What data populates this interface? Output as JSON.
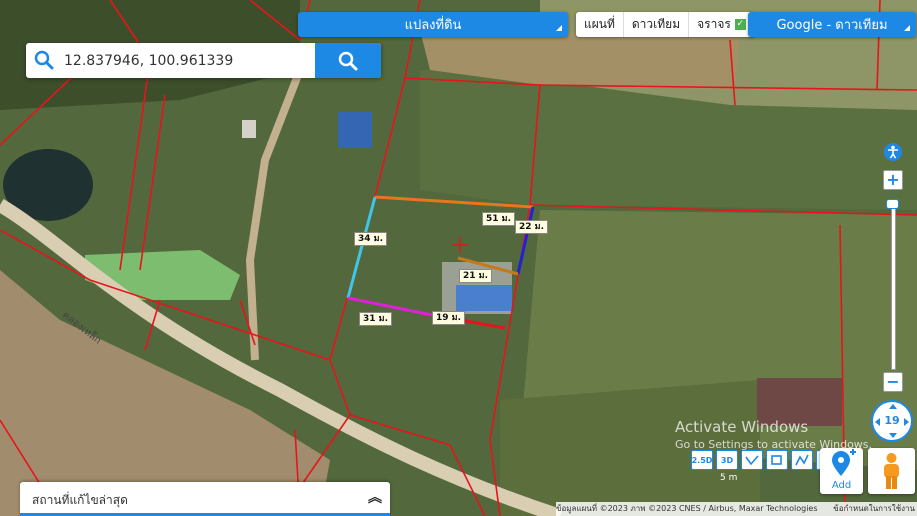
{
  "layer_dropdown": {
    "label": "แปลงที่ดิน"
  },
  "map_type": {
    "items": [
      "แผนที่",
      "ดาวเทียม",
      "จราจร"
    ]
  },
  "basemap_dropdown": {
    "label": "Google - ดาวเทียม"
  },
  "search": {
    "value": "12.837946, 100.961339"
  },
  "measurements": {
    "top": "51 ม.",
    "right": "22 ม.",
    "left": "34 ม.",
    "bottom": "31 ม.",
    "inner_top": "21 ม.",
    "inner_bottom": "19 ม."
  },
  "road_label": "คลองเหล็ก",
  "zoom": {
    "level": "19",
    "plus": "+",
    "minus": "−"
  },
  "tools": [
    "2.5D",
    "3D"
  ],
  "add_button": {
    "label": "Add"
  },
  "recent_panel": {
    "label": "สถานที่แก้ไขล่าสุด"
  },
  "attribution": {
    "text": "ข้อมูลแผนที่ ©2023 ภาพ ©2023 CNES / Airbus, Maxar Technologies",
    "terms": "ข้อกำหนดในการใช้งาน"
  },
  "scale_label": "5 m",
  "watermark": {
    "title": "Activate Windows",
    "subtitle": "Go to Settings to activate Windows."
  },
  "colors": {
    "accent": "#1e88e5",
    "parcel_line": "#e8141c",
    "seg_top": "#e8761a",
    "seg_right": "#1f22d6",
    "seg_left": "#3ec7e8",
    "seg_bottom": "#e020d8",
    "seg_inner": "#c47a18"
  }
}
